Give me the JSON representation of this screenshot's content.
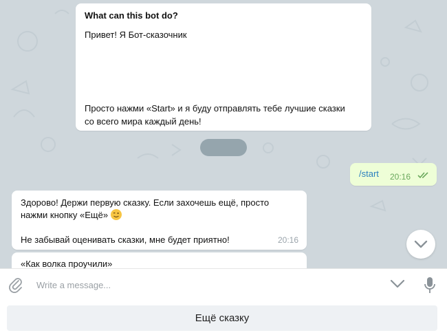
{
  "bot_info": {
    "title": "What can this bot do?",
    "greeting": "Привет! Я Бот-сказочник",
    "description_line1": "Просто нажми «Start» и я буду отправлять тебе лучшие сказки",
    "description_line2": "со всего мира каждый день!"
  },
  "outgoing_message": {
    "text": "/start",
    "time": "20:16",
    "status": "read"
  },
  "incoming_message": {
    "line1": "Здорово! Держи первую сказку. Если захочешь ещё, просто",
    "line2": "нажми кнопку «Ещё»",
    "emoji": "winking-face",
    "line3": "Не забывай оценивать сказки, мне будет приятно!",
    "time": "20:16"
  },
  "incoming_message_2": {
    "text": "«Как волка проучили»"
  },
  "composer": {
    "placeholder": "Write a message..."
  },
  "bot_keyboard": {
    "button_label": "Ещё сказку"
  },
  "colors": {
    "chat_background": "#cfd7dc",
    "outgoing_bubble": "#eefed7",
    "link_blue": "#2a7fbf",
    "read_check_green": "#6aa85c"
  }
}
